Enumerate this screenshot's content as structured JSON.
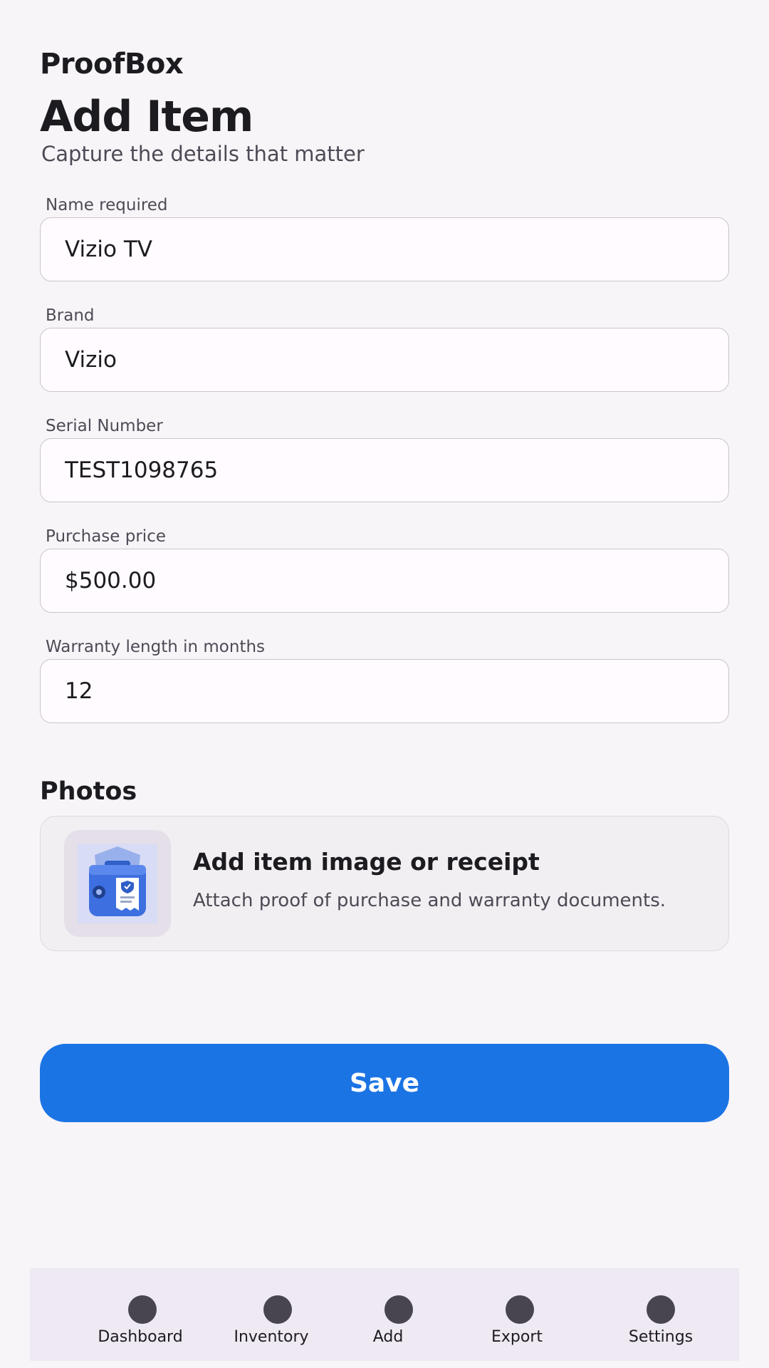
{
  "header": {
    "app_name": "ProofBox",
    "title": "Add Item",
    "subtitle": "Capture the details that matter"
  },
  "form": {
    "name": {
      "label": "Name required",
      "value": "Vizio TV"
    },
    "brand": {
      "label": "Brand",
      "value": "Vizio"
    },
    "serial": {
      "label": "Serial Number",
      "value": "TEST1098765"
    },
    "price": {
      "label": "Purchase price",
      "value": "$500.00"
    },
    "warranty": {
      "label": "Warranty length in months",
      "value": "12"
    }
  },
  "photos": {
    "section_title": "Photos",
    "card_title": "Add item image or receipt",
    "card_description": "Attach proof of purchase and warranty documents.",
    "thumbnail_icon": "warranty-box-icon"
  },
  "actions": {
    "save_label": "Save",
    "accent_color": "#1b74e4"
  },
  "nav": {
    "items": [
      {
        "label": "Dashboard",
        "icon": "dot-icon"
      },
      {
        "label": "Inventory",
        "icon": "dot-icon"
      },
      {
        "label": "Add",
        "icon": "dot-icon"
      },
      {
        "label": "Export",
        "icon": "dot-icon"
      },
      {
        "label": "Settings",
        "icon": "dot-icon"
      }
    ]
  }
}
